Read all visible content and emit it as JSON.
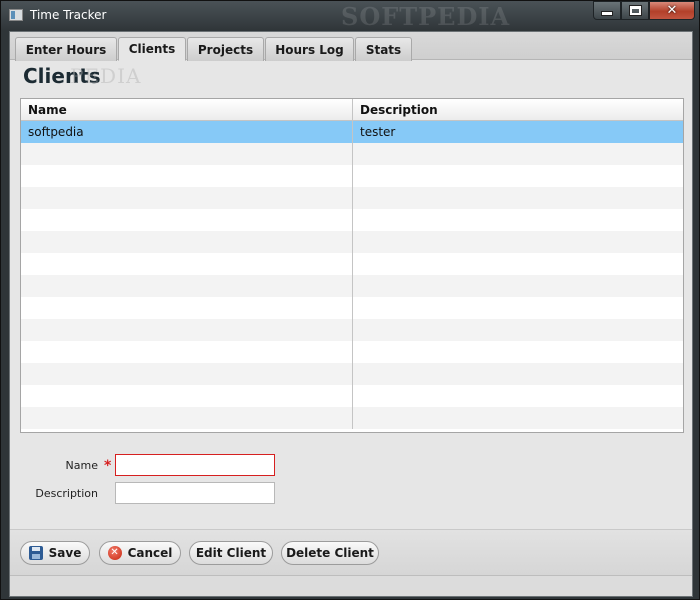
{
  "window": {
    "title": "Time Tracker",
    "watermark": "SOFTPEDIA",
    "minimize_glyph": "",
    "maximize_glyph": "",
    "close_glyph": "✕"
  },
  "tabs": [
    {
      "label": "Enter Hours",
      "active": false
    },
    {
      "label": "Clients",
      "active": true
    },
    {
      "label": "Projects",
      "active": false
    },
    {
      "label": "Hours Log",
      "active": false
    },
    {
      "label": "Stats",
      "active": false
    }
  ],
  "page": {
    "title": "Clients",
    "watermark": "PEDIA"
  },
  "table": {
    "columns": [
      "Name",
      "Description"
    ],
    "rows": [
      {
        "name": "softpedia",
        "description": "tester",
        "selected": true
      }
    ],
    "empty_row_count": 13
  },
  "form": {
    "name_label": "Name",
    "name_value": "",
    "name_required": "*",
    "description_label": "Description",
    "description_value": ""
  },
  "buttons": {
    "save": "Save",
    "cancel": "Cancel",
    "edit": "Edit Client",
    "delete": "Delete Client"
  },
  "colors": {
    "selection": "#86c9f7",
    "required": "#d62020"
  },
  "icons": {
    "save": "floppy-disk-icon",
    "cancel": "cancel-circle-icon"
  }
}
